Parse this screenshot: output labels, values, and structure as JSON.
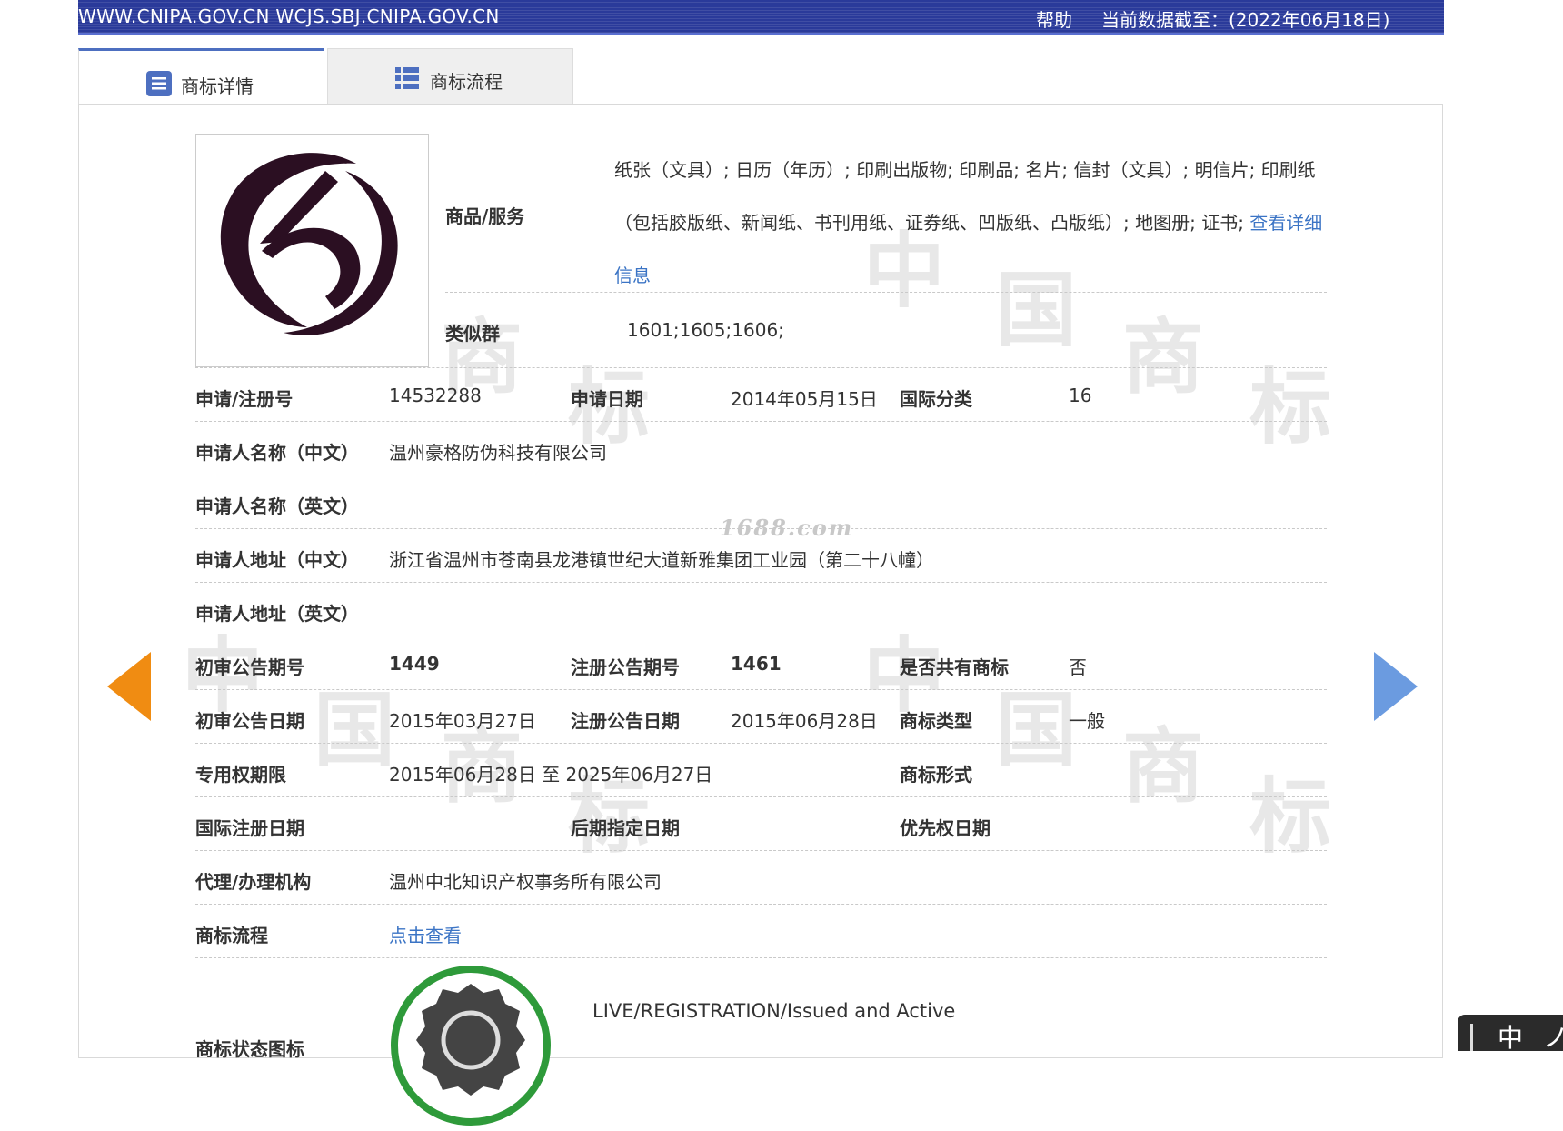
{
  "topbar": {
    "site": "WWW.CNIPA.GOV.CN WCJS.SBJ.CNIPA.GOV.CN",
    "help": "帮助",
    "data_as_of": "当前数据截至：(2022年06月18日)"
  },
  "tabs": [
    {
      "label": "商标详情",
      "active": true,
      "icon": "document-list-icon"
    },
    {
      "label": "商标流程",
      "active": false,
      "icon": "list-icon"
    }
  ],
  "watermark": {
    "chars": [
      "中",
      "国",
      "商",
      "标"
    ],
    "site": "1688.com"
  },
  "detail": {
    "goods_label": "商品/服务",
    "goods_value": "纸张（文具）; 日历（年历）; 印刷出版物; 印刷品; 名片; 信封（文具）; 明信片; 印刷纸（包括胶版纸、新闻纸、书刊用纸、证券纸、凹版纸、凸版纸）; 地图册; 证书; ",
    "goods_more_link": "查看详细信息",
    "similar_group_label": "类似群",
    "similar_group_value": "1601;1605;1606;",
    "reg_no_label": "申请/注册号",
    "reg_no_value": "14532288",
    "apply_date_label": "申请日期",
    "apply_date_value": "2014年05月15日",
    "intl_class_label": "国际分类",
    "intl_class_value": "16",
    "applicant_cn_label": "申请人名称（中文）",
    "applicant_cn_value": "温州豪格防伪科技有限公司",
    "applicant_en_label": "申请人名称（英文）",
    "applicant_en_value": "",
    "address_cn_label": "申请人地址（中文）",
    "address_cn_value": "浙江省温州市苍南县龙港镇世纪大道新雅集团工业园（第二十八幢）",
    "address_en_label": "申请人地址（英文）",
    "address_en_value": "",
    "prelim_issue_label": "初审公告期号",
    "prelim_issue_value": "1449",
    "reg_issue_label": "注册公告期号",
    "reg_issue_value": "1461",
    "shared_label": "是否共有商标",
    "shared_value": "否",
    "prelim_date_label": "初审公告日期",
    "prelim_date_value": "2015年03月27日",
    "reg_date_label": "注册公告日期",
    "reg_date_value": "2015年06月28日",
    "mark_type_label": "商标类型",
    "mark_type_value": "一般",
    "exclusive_period_label": "专用权期限",
    "exclusive_period_value": "2015年06月28日 至 2025年06月27日",
    "mark_form_label": "商标形式",
    "mark_form_value": "",
    "intl_reg_date_label": "国际注册日期",
    "later_designation_label": "后期指定日期",
    "priority_date_label": "优先权日期",
    "agent_label": "代理/办理机构",
    "agent_value": "温州中北知识产权事务所有限公司",
    "flow_label": "商标流程",
    "flow_link": "点击查看",
    "status_icon_label": "商标状态图标",
    "status_text": "LIVE/REGISTRATION/Issued and Active"
  },
  "ime": {
    "mode": "中",
    "more": "ノ"
  },
  "colors": {
    "topbar": "#2a3a9a",
    "link": "#3b74c5",
    "arrow_left": "#f08c12",
    "arrow_right": "#6b9be0",
    "status_ring": "#2e9a3a"
  }
}
